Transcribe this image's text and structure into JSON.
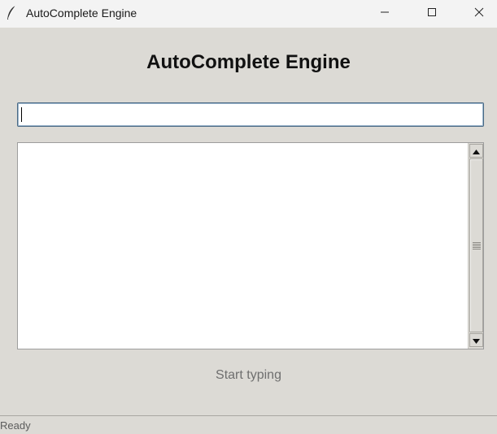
{
  "window": {
    "title": "AutoComplete Engine",
    "app_icon": "feather-icon",
    "controls": [
      "minimize-icon",
      "maximize-icon",
      "close-icon"
    ]
  },
  "main": {
    "heading": "AutoComplete Engine",
    "search": {
      "value": "",
      "placeholder": ""
    },
    "suggestions": [],
    "hint": "Start typing"
  },
  "statusbar": {
    "text": "Ready"
  },
  "colors": {
    "background": "#dcdad5",
    "titlebar": "#f3f3f3",
    "entry_border": "#4a6984",
    "hint_text": "#6f6f6f"
  }
}
